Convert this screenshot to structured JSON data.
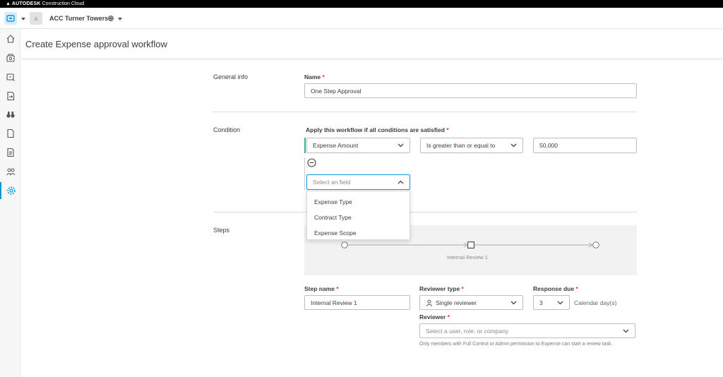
{
  "brand": {
    "company": "AUTODESK",
    "product": "Construction Cloud"
  },
  "project": {
    "name": "ACC Turner Towers"
  },
  "page": {
    "title": "Create Expense approval workflow"
  },
  "sidebar": {
    "items": [
      {
        "icon": "home-icon"
      },
      {
        "icon": "budget-icon"
      },
      {
        "icon": "cost-icon"
      },
      {
        "icon": "change-order-icon"
      },
      {
        "icon": "binoculars-icon"
      },
      {
        "icon": "document-icon"
      },
      {
        "icon": "forms-icon"
      },
      {
        "icon": "members-icon"
      },
      {
        "icon": "settings-icon",
        "active": true
      }
    ]
  },
  "general": {
    "section": "General info",
    "name_label": "Name",
    "name_value": "One Step Approval"
  },
  "condition": {
    "section": "Condition",
    "label": "Apply this workflow if all conditions are satisfied",
    "field": "Expense Amount",
    "operator": "Is greater than or equal to",
    "value": "50,000",
    "new_field_placeholder": "Select an field",
    "options": [
      "Expense Type",
      "Contract Type",
      "Expense Scope"
    ]
  },
  "steps": {
    "section": "Steps",
    "node_label": "Internal Review 1",
    "step_name_label": "Step name",
    "step_name_value": "Internal Review 1",
    "reviewer_type_label": "Reviewer type",
    "reviewer_type_value": "Single reviewer",
    "response_due_label": "Response due",
    "response_due_value": "3",
    "response_due_unit": "Calendar day(s)",
    "reviewer_label": "Reviewer",
    "reviewer_placeholder": "Select a user, role, or company",
    "reviewer_hint": "Only members with Full Control or Admin permission to Expense can start a review task."
  },
  "colors": {
    "accent": "#0696d7",
    "required": "#e32222",
    "condition_bar": "#2bb5a8"
  }
}
